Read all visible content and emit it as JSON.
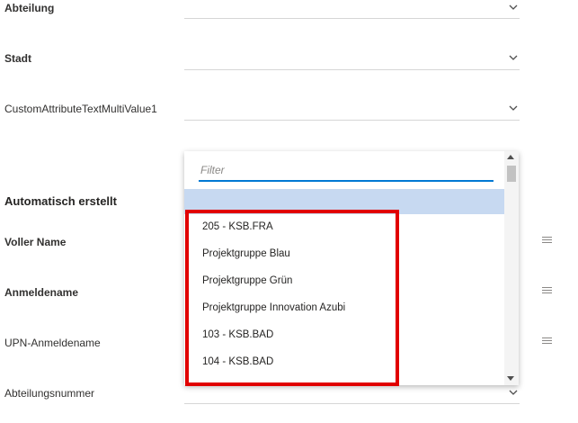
{
  "fields": [
    {
      "label": "Abteilung"
    },
    {
      "label": "Stadt"
    },
    {
      "label": "CustomAttributeTextMultiValue1"
    }
  ],
  "section": {
    "heading": "Automatisch erstellt"
  },
  "auto_fields": [
    {
      "label": "Voller Name"
    },
    {
      "label": "Anmeldename"
    },
    {
      "label": "UPN-Anmeldename"
    },
    {
      "label": "Abteilungsnummer"
    }
  ],
  "dropdown": {
    "filter_placeholder": "Filter",
    "options": [
      "205 - KSB.FRA",
      "Projektgruppe Blau",
      "Projektgruppe Grün",
      "Projektgruppe Innovation Azubi",
      "103 - KSB.BAD",
      "104 - KSB.BAD"
    ]
  },
  "colors": {
    "accent": "#0078d4",
    "selected_row": "#c7d9f1",
    "highlight": "#e10000"
  },
  "icons": {
    "chevron": "chevron-down-icon",
    "menu": "hamburger-menu-icon"
  }
}
